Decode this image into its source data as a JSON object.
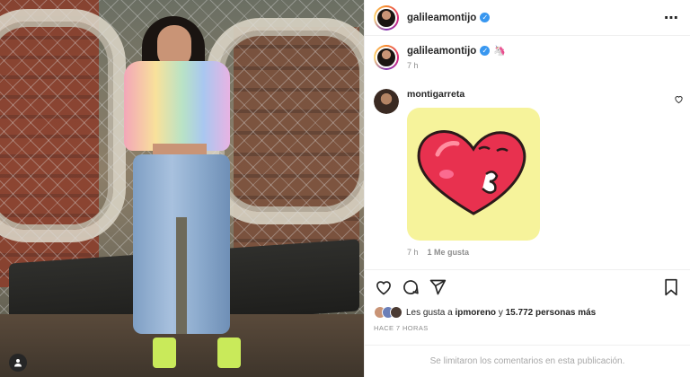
{
  "post": {
    "author": "galileamontijo",
    "caption_author": "galileamontijo",
    "caption_emoji": "🦄",
    "caption_time": "7 h",
    "more_icon": "⋯"
  },
  "comment": {
    "author": "montigarreta",
    "time": "7 h",
    "likes": "1 Me gusta"
  },
  "likes": {
    "prefix": "Les gusta a ",
    "user": "ipmoreno",
    "middle": " y ",
    "count": "15.772 personas más"
  },
  "posted": "HACE 7 HORAS",
  "comments_limited": "Se limitaron los comentarios en esta publicación.",
  "icons": {
    "like": "heart-icon",
    "comment": "comment-icon",
    "share": "share-icon",
    "save": "bookmark-icon",
    "corner": "user-tag-icon"
  },
  "colors": {
    "verified": "#3897f0",
    "sticker_bg": "#f6f39b",
    "sticker_heart": "#e8314f"
  }
}
